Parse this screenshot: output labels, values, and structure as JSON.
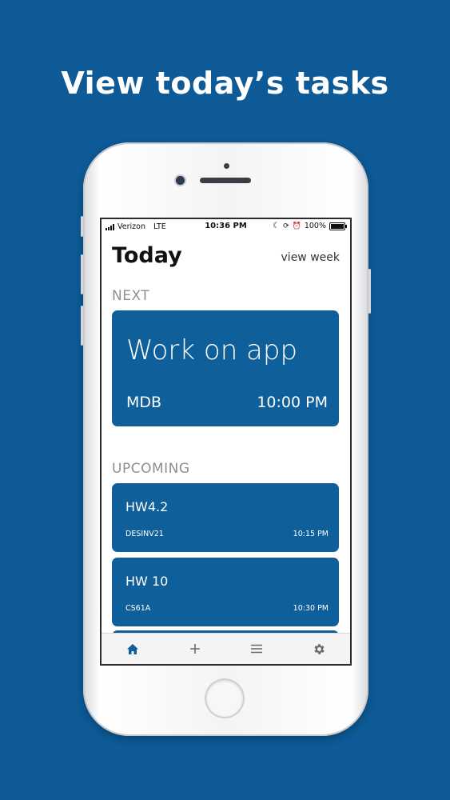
{
  "headline": "View today’s tasks",
  "status_bar": {
    "carrier": "Verizon",
    "network": "LTE",
    "time": "10:36 PM",
    "battery": "100%"
  },
  "header": {
    "title": "Today",
    "view_week_label": "view week"
  },
  "next_section": {
    "label": "NEXT",
    "task": {
      "name": "Work on app",
      "class": "MDB",
      "time": "10:00 PM"
    }
  },
  "upcoming_section": {
    "label": "UPCOMING",
    "tasks": [
      {
        "name": "HW4.2",
        "class": "DESINV21",
        "time": "10:15 PM"
      },
      {
        "name": "HW 10",
        "class": "CS61A",
        "time": "10:30 PM"
      }
    ]
  },
  "tab_bar": {
    "items": [
      {
        "icon": "home-icon",
        "active": true
      },
      {
        "icon": "plus-icon",
        "active": false
      },
      {
        "icon": "menu-icon",
        "active": false
      },
      {
        "icon": "gear-icon",
        "active": false
      }
    ]
  },
  "colors": {
    "background": "#0d5a96",
    "card": "#0f5f9a",
    "active_tab": "#0f5f9a",
    "inactive_tab": "#6b6b6b"
  }
}
